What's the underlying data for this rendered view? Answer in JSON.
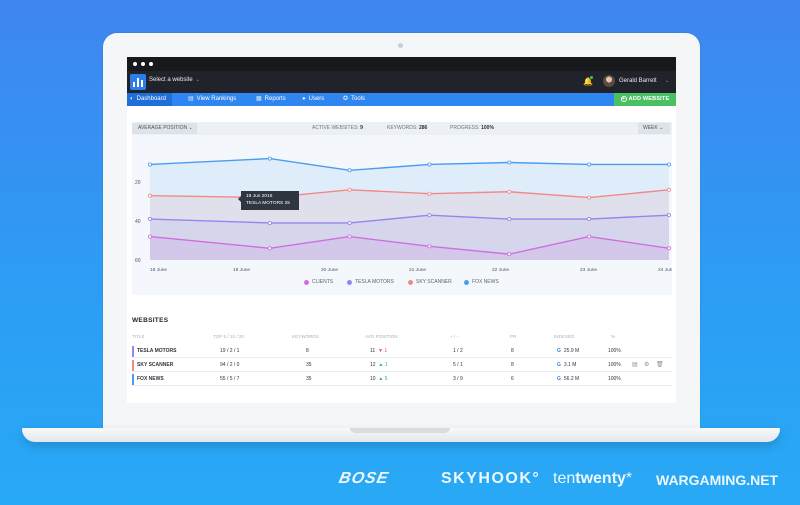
{
  "browser": {
    "dots": 3
  },
  "header": {
    "site_select": "Select a website",
    "user_name": "Gerald Barrett"
  },
  "nav": {
    "items": [
      {
        "label": "Dashboard",
        "icon": "speedometer-icon",
        "active": true
      },
      {
        "label": "View Rankings",
        "icon": "chart-icon",
        "active": false
      },
      {
        "label": "Reports",
        "icon": "report-icon",
        "active": false
      },
      {
        "label": "Users",
        "icon": "users-icon",
        "active": false
      },
      {
        "label": "Tools",
        "icon": "tools-icon",
        "active": false
      }
    ],
    "add_website": "ADD WEBSITE"
  },
  "filters": {
    "average_position": "AVERAGE POSITION",
    "active_websites_label": "ACTIVE WEBSITES:",
    "active_websites_value": "9",
    "keywords_label": "KEYWORDS:",
    "keywords_value": "286",
    "progress_label": "PROGRESS:",
    "progress_value": "100%",
    "week": "WEEK"
  },
  "chart_data": {
    "type": "area",
    "categories": [
      "18 June",
      "19 June",
      "20 June",
      "21 June",
      "22 June",
      "23 June",
      "24 June"
    ],
    "x_positions_days": [
      18,
      19.5,
      20.5,
      21.5,
      22.5,
      23.5,
      24.5
    ],
    "y_ticks": [
      20,
      40,
      60
    ],
    "ylim": [
      60,
      0
    ],
    "grid": false,
    "legend_position": "bottom",
    "series": [
      {
        "name": "CLIENTS",
        "color": "#d06ee0",
        "values": [
          48,
          54,
          48,
          53,
          57,
          48,
          54
        ]
      },
      {
        "name": "TESLA MOTORS",
        "color": "#8f88ee",
        "values": [
          39,
          41,
          41,
          37,
          39,
          39,
          37
        ]
      },
      {
        "name": "SKY SCANNER",
        "color": "#f08a8a",
        "values": [
          27,
          28,
          24,
          26,
          25,
          28,
          24
        ]
      },
      {
        "name": "FOX NEWS",
        "color": "#4b9cf0",
        "values": [
          11,
          8,
          14,
          11,
          10,
          11,
          11
        ]
      }
    ],
    "tooltip": {
      "date": "19 Jun 2016",
      "series": "TESLA MOTORS",
      "value": "25"
    }
  },
  "websites": {
    "title": "WEBSITES",
    "columns": [
      "TITLE",
      "TOP 5 / 10 / 20",
      "KEYWORDS",
      "AVG POSITION",
      "+ / -",
      "PR",
      "INDEXED",
      "%"
    ],
    "rows": [
      {
        "title": "TESLA MOTORS",
        "top": "19 / 2 / 1",
        "keywords": "8",
        "avg": "11",
        "avg_change": "1",
        "avg_dir": "down",
        "plusminus": "1 / 2",
        "pr": "8",
        "indexed": "25.9 M",
        "indexed_icon": "google-g-icon",
        "percent": "100%",
        "bar_color": "#8f88ee"
      },
      {
        "title": "SKY SCANNER",
        "top": "94 / 2 / 0",
        "keywords": "35",
        "avg": "12",
        "avg_change": "1",
        "avg_dir": "up",
        "plusminus": "5 / 1",
        "pr": "8",
        "indexed": "3.1 M",
        "indexed_icon": "google-g-icon",
        "percent": "100%",
        "bar_color": "#f08a8a"
      },
      {
        "title": "FOX NEWS",
        "top": "55 / 5 / 7",
        "keywords": "35",
        "avg": "10",
        "avg_change": "5",
        "avg_dir": "up",
        "plusminus": "3 / 9",
        "pr": "6",
        "indexed": "56.2 M",
        "indexed_icon": "google-g-icon",
        "percent": "100%",
        "bar_color": "#4b9cf0"
      }
    ]
  },
  "brands": [
    "BOSE",
    "SKYHOOK",
    "ten",
    "twenty",
    "WARGAMING.NET"
  ]
}
